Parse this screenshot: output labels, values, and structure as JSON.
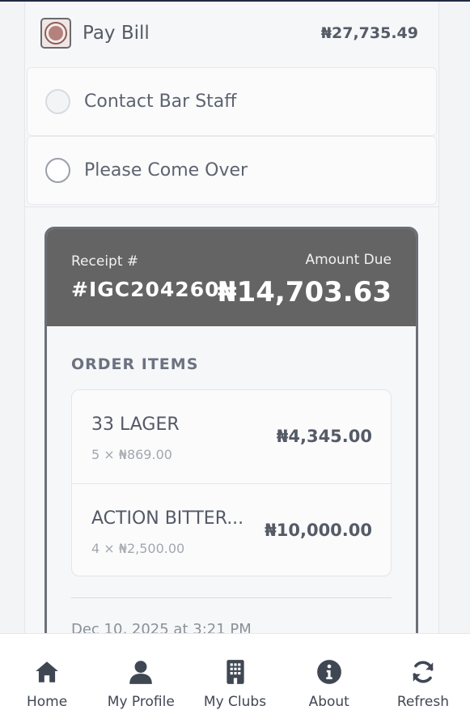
{
  "options": {
    "pay_bill": {
      "label": "Pay Bill",
      "amount": "₦27,735.49"
    },
    "contact_bar": {
      "label": "Contact Bar Staff"
    },
    "come_over": {
      "label": "Please Come Over"
    }
  },
  "receipt": {
    "receipt_label": "Receipt #",
    "receipt_number": "#IGC204260",
    "amount_label": "Amount Due",
    "amount_value": "₦14,703.63",
    "items_title": "ORDER ITEMS",
    "items": [
      {
        "name": "33 LAGER",
        "qty": "5 × ₦869.00",
        "price": "₦4,345.00"
      },
      {
        "name": "ACTION BITTER...",
        "qty": "4 × ₦2,500.00",
        "price": "₦10,000.00"
      }
    ],
    "date": "Dec 10, 2025 at 3:21 PM"
  },
  "nav": {
    "items": [
      {
        "label": "Home",
        "icon": "home-icon"
      },
      {
        "label": "My Profile",
        "icon": "user-icon"
      },
      {
        "label": "My Clubs",
        "icon": "building-icon"
      },
      {
        "label": "About",
        "icon": "info-icon"
      },
      {
        "label": "Refresh",
        "icon": "refresh-icon"
      }
    ]
  },
  "colors": {
    "receipt_header": "#636463",
    "selected_radio": "#b4817c",
    "nav_text": "#3f4753"
  }
}
